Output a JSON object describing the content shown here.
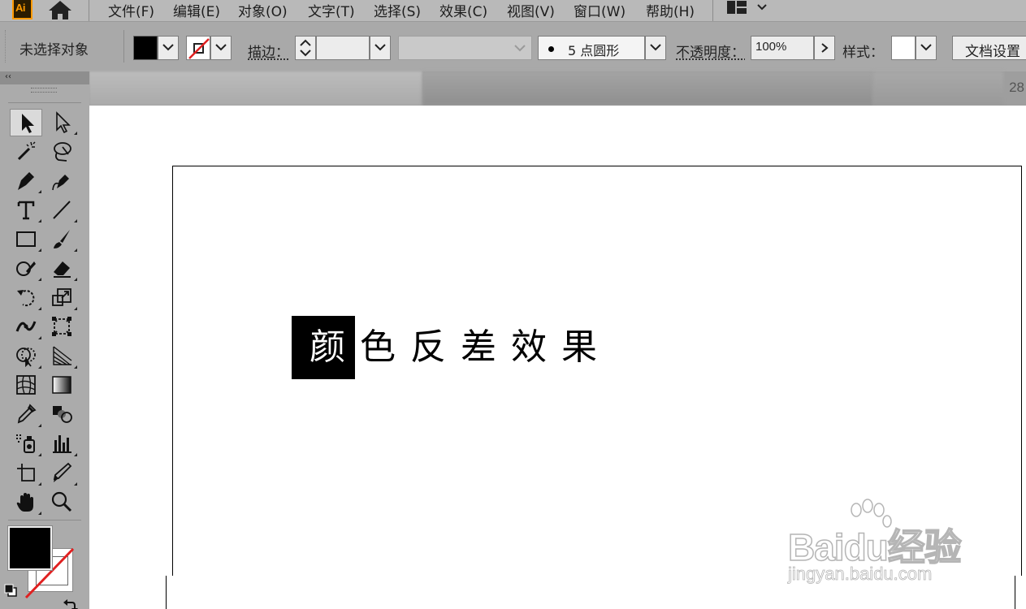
{
  "menubar": {
    "app_logo": "Ai",
    "items": [
      "文件(F)",
      "编辑(E)",
      "对象(O)",
      "文字(T)",
      "选择(S)",
      "效果(C)",
      "视图(V)",
      "窗口(W)",
      "帮助(H)"
    ]
  },
  "controlbar": {
    "selection_label": "未选择对象",
    "stroke_label": "描边：",
    "brush_points": "5",
    "brush_shape": "点圆形",
    "opacity_label": "不透明度：",
    "opacity_value": "100%",
    "style_label": "样式：",
    "doc_setup_button": "文档设置"
  },
  "tabstrip": {
    "zoom_fragment": "28"
  },
  "tools": {
    "names": [
      "selection",
      "direct-selection",
      "magic-wand",
      "lasso",
      "pen",
      "curvature",
      "type",
      "line-segment",
      "rectangle",
      "paintbrush",
      "shaper",
      "eraser",
      "rotate",
      "scale",
      "width",
      "free-transform",
      "shape-builder",
      "perspective-grid",
      "mesh",
      "gradient",
      "eyedropper",
      "blend",
      "symbol-sprayer",
      "column-graph",
      "artboard",
      "slice",
      "hand",
      "zoom"
    ],
    "active": "selection",
    "fill_color": "#000000",
    "stroke_color": "none"
  },
  "canvas": {
    "words": [
      "颜",
      "色",
      "反",
      "差",
      "效",
      "果"
    ],
    "inverted_index": 0,
    "text_color": "#000000",
    "highlight_color": "#000000"
  },
  "watermark": {
    "brand": "Baidu经验",
    "url": "jingyan.baidu.com"
  },
  "colors": {
    "accent": "#ff9a00",
    "menubar_bg": "#b9b9b9",
    "toolbar_bg": "#ababab",
    "stroke_none": "#e02020"
  }
}
